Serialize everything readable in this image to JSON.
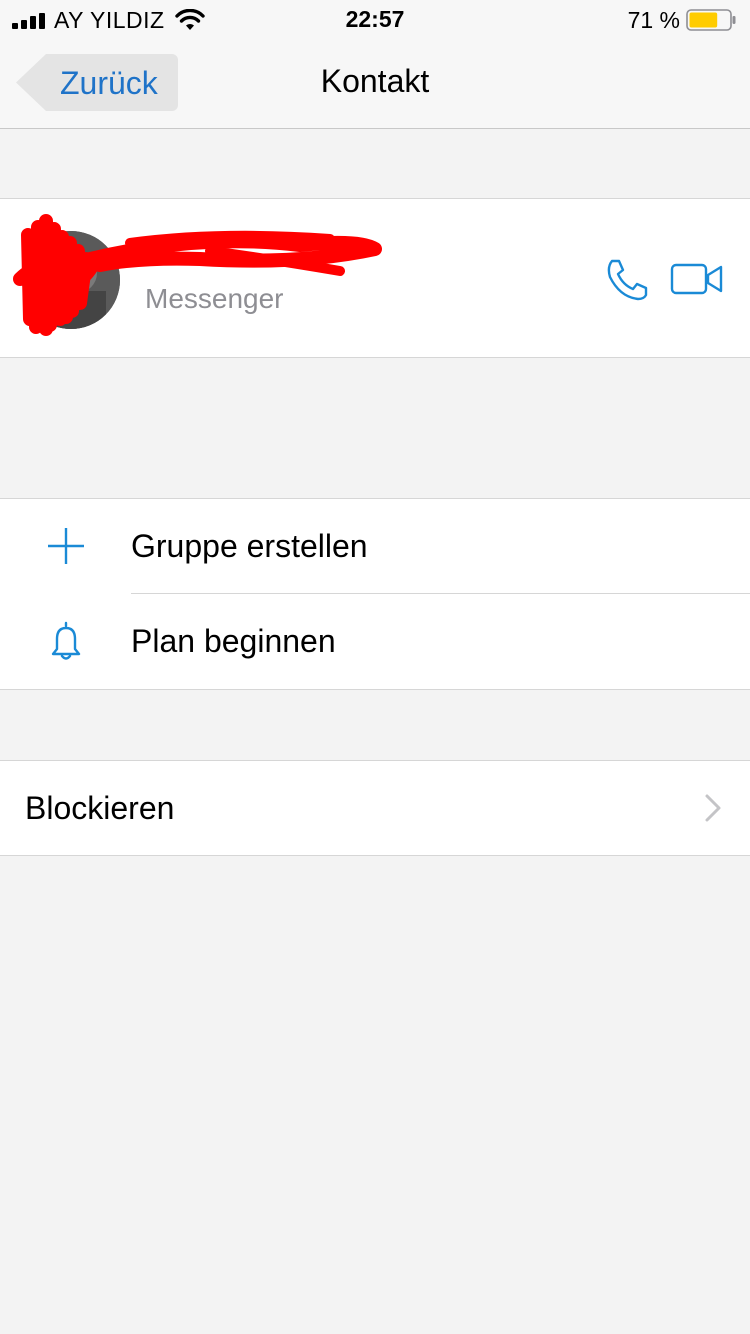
{
  "status_bar": {
    "carrier": "AY YILDIZ",
    "time": "22:57",
    "battery_percent": "71 %",
    "battery_level": 0.71,
    "battery_color": "#ffcc00"
  },
  "nav": {
    "back_label": "Zurück",
    "title": "Kontakt"
  },
  "contact": {
    "name": "",
    "subtitle": "Messenger",
    "actions": [
      {
        "icon": "phone-icon"
      },
      {
        "icon": "video-camera-icon"
      }
    ]
  },
  "menu": {
    "items": [
      {
        "icon": "plus-icon",
        "label": "Gruppe erstellen"
      },
      {
        "icon": "bell-icon",
        "label": "Plan beginnen"
      }
    ]
  },
  "block": {
    "label": "Blockieren",
    "icon": "chevron-right-icon"
  },
  "colors": {
    "accent": "#1f73c8",
    "icon_blue": "#1a8ad6",
    "redaction": "#ff0000",
    "background": "#f3f3f3"
  }
}
